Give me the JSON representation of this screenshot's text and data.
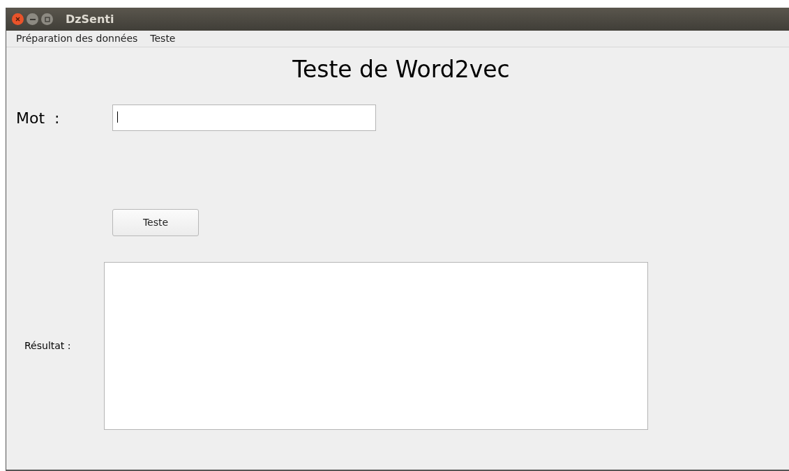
{
  "window": {
    "title": "DzSenti"
  },
  "menu": [
    {
      "label": "Préparation des données"
    },
    {
      "label": "Teste"
    }
  ],
  "heading": "Teste de Word2vec",
  "word_field": {
    "label": "Mot  :",
    "focused": true
  },
  "test_button": {
    "label": "Teste"
  },
  "result": {
    "label": "Résultat :"
  }
}
